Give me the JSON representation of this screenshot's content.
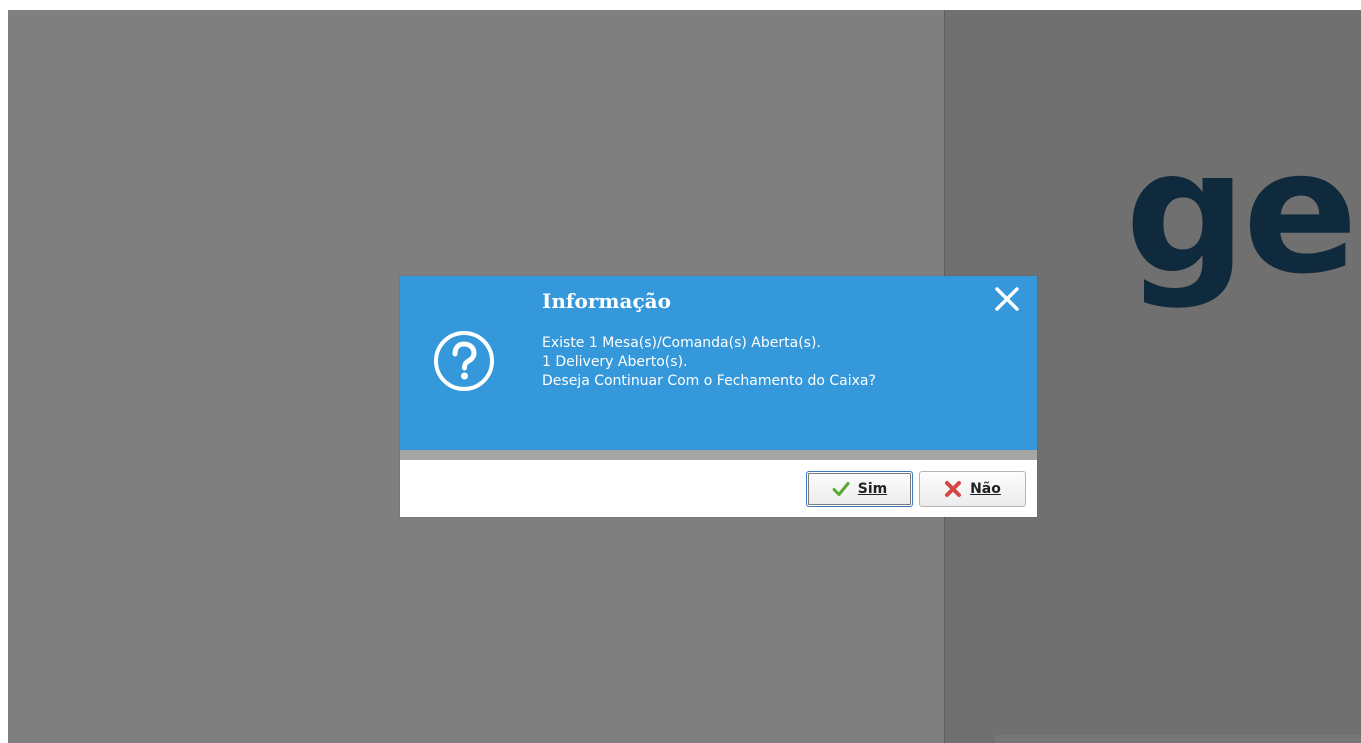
{
  "background": {
    "brand_text": "ges"
  },
  "dialog": {
    "title": "Informação",
    "message_lines": [
      "Existe 1 Mesa(s)/Comanda(s) Aberta(s).",
      "1 Delivery Aberto(s).",
      "Deseja Continuar Com o Fechamento do Caixa?"
    ],
    "icon": "question-circle-icon",
    "close_icon": "close-icon",
    "buttons": {
      "yes": {
        "label": "Sim",
        "icon": "checkmark-icon"
      },
      "no": {
        "label": "Não",
        "icon": "x-mark-icon"
      }
    }
  },
  "colors": {
    "dialog_header": "#3498db",
    "backdrop": "#7f7f7f",
    "brand_text": "#0f2a3c",
    "yes_icon": "#5aa832",
    "no_icon": "#d64545"
  }
}
